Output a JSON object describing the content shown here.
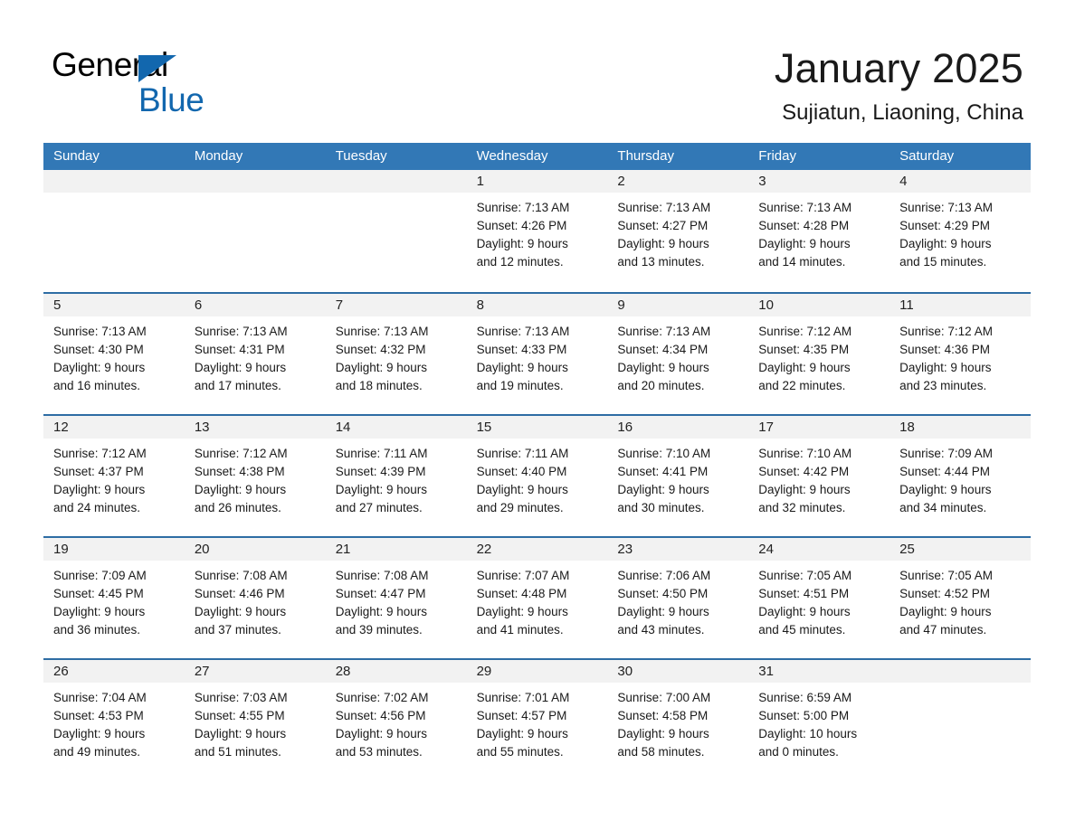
{
  "brand": {
    "name_line1": "General",
    "name_line2": "Blue",
    "flag_icon": "triangle-flag-icon",
    "accent_color": "#1267ae"
  },
  "header": {
    "month_title": "January 2025",
    "location": "Sujiatun, Liaoning, China"
  },
  "calendar": {
    "header_bg": "#3278b6",
    "row_divider_color": "#2e6da4",
    "date_band_bg": "#f2f2f2",
    "weekdays": [
      "Sunday",
      "Monday",
      "Tuesday",
      "Wednesday",
      "Thursday",
      "Friday",
      "Saturday"
    ],
    "weeks": [
      [
        {
          "date": "",
          "lines": []
        },
        {
          "date": "",
          "lines": []
        },
        {
          "date": "",
          "lines": []
        },
        {
          "date": "1",
          "lines": [
            "Sunrise: 7:13 AM",
            "Sunset: 4:26 PM",
            "Daylight: 9 hours",
            "and 12 minutes."
          ]
        },
        {
          "date": "2",
          "lines": [
            "Sunrise: 7:13 AM",
            "Sunset: 4:27 PM",
            "Daylight: 9 hours",
            "and 13 minutes."
          ]
        },
        {
          "date": "3",
          "lines": [
            "Sunrise: 7:13 AM",
            "Sunset: 4:28 PM",
            "Daylight: 9 hours",
            "and 14 minutes."
          ]
        },
        {
          "date": "4",
          "lines": [
            "Sunrise: 7:13 AM",
            "Sunset: 4:29 PM",
            "Daylight: 9 hours",
            "and 15 minutes."
          ]
        }
      ],
      [
        {
          "date": "5",
          "lines": [
            "Sunrise: 7:13 AM",
            "Sunset: 4:30 PM",
            "Daylight: 9 hours",
            "and 16 minutes."
          ]
        },
        {
          "date": "6",
          "lines": [
            "Sunrise: 7:13 AM",
            "Sunset: 4:31 PM",
            "Daylight: 9 hours",
            "and 17 minutes."
          ]
        },
        {
          "date": "7",
          "lines": [
            "Sunrise: 7:13 AM",
            "Sunset: 4:32 PM",
            "Daylight: 9 hours",
            "and 18 minutes."
          ]
        },
        {
          "date": "8",
          "lines": [
            "Sunrise: 7:13 AM",
            "Sunset: 4:33 PM",
            "Daylight: 9 hours",
            "and 19 minutes."
          ]
        },
        {
          "date": "9",
          "lines": [
            "Sunrise: 7:13 AM",
            "Sunset: 4:34 PM",
            "Daylight: 9 hours",
            "and 20 minutes."
          ]
        },
        {
          "date": "10",
          "lines": [
            "Sunrise: 7:12 AM",
            "Sunset: 4:35 PM",
            "Daylight: 9 hours",
            "and 22 minutes."
          ]
        },
        {
          "date": "11",
          "lines": [
            "Sunrise: 7:12 AM",
            "Sunset: 4:36 PM",
            "Daylight: 9 hours",
            "and 23 minutes."
          ]
        }
      ],
      [
        {
          "date": "12",
          "lines": [
            "Sunrise: 7:12 AM",
            "Sunset: 4:37 PM",
            "Daylight: 9 hours",
            "and 24 minutes."
          ]
        },
        {
          "date": "13",
          "lines": [
            "Sunrise: 7:12 AM",
            "Sunset: 4:38 PM",
            "Daylight: 9 hours",
            "and 26 minutes."
          ]
        },
        {
          "date": "14",
          "lines": [
            "Sunrise: 7:11 AM",
            "Sunset: 4:39 PM",
            "Daylight: 9 hours",
            "and 27 minutes."
          ]
        },
        {
          "date": "15",
          "lines": [
            "Sunrise: 7:11 AM",
            "Sunset: 4:40 PM",
            "Daylight: 9 hours",
            "and 29 minutes."
          ]
        },
        {
          "date": "16",
          "lines": [
            "Sunrise: 7:10 AM",
            "Sunset: 4:41 PM",
            "Daylight: 9 hours",
            "and 30 minutes."
          ]
        },
        {
          "date": "17",
          "lines": [
            "Sunrise: 7:10 AM",
            "Sunset: 4:42 PM",
            "Daylight: 9 hours",
            "and 32 minutes."
          ]
        },
        {
          "date": "18",
          "lines": [
            "Sunrise: 7:09 AM",
            "Sunset: 4:44 PM",
            "Daylight: 9 hours",
            "and 34 minutes."
          ]
        }
      ],
      [
        {
          "date": "19",
          "lines": [
            "Sunrise: 7:09 AM",
            "Sunset: 4:45 PM",
            "Daylight: 9 hours",
            "and 36 minutes."
          ]
        },
        {
          "date": "20",
          "lines": [
            "Sunrise: 7:08 AM",
            "Sunset: 4:46 PM",
            "Daylight: 9 hours",
            "and 37 minutes."
          ]
        },
        {
          "date": "21",
          "lines": [
            "Sunrise: 7:08 AM",
            "Sunset: 4:47 PM",
            "Daylight: 9 hours",
            "and 39 minutes."
          ]
        },
        {
          "date": "22",
          "lines": [
            "Sunrise: 7:07 AM",
            "Sunset: 4:48 PM",
            "Daylight: 9 hours",
            "and 41 minutes."
          ]
        },
        {
          "date": "23",
          "lines": [
            "Sunrise: 7:06 AM",
            "Sunset: 4:50 PM",
            "Daylight: 9 hours",
            "and 43 minutes."
          ]
        },
        {
          "date": "24",
          "lines": [
            "Sunrise: 7:05 AM",
            "Sunset: 4:51 PM",
            "Daylight: 9 hours",
            "and 45 minutes."
          ]
        },
        {
          "date": "25",
          "lines": [
            "Sunrise: 7:05 AM",
            "Sunset: 4:52 PM",
            "Daylight: 9 hours",
            "and 47 minutes."
          ]
        }
      ],
      [
        {
          "date": "26",
          "lines": [
            "Sunrise: 7:04 AM",
            "Sunset: 4:53 PM",
            "Daylight: 9 hours",
            "and 49 minutes."
          ]
        },
        {
          "date": "27",
          "lines": [
            "Sunrise: 7:03 AM",
            "Sunset: 4:55 PM",
            "Daylight: 9 hours",
            "and 51 minutes."
          ]
        },
        {
          "date": "28",
          "lines": [
            "Sunrise: 7:02 AM",
            "Sunset: 4:56 PM",
            "Daylight: 9 hours",
            "and 53 minutes."
          ]
        },
        {
          "date": "29",
          "lines": [
            "Sunrise: 7:01 AM",
            "Sunset: 4:57 PM",
            "Daylight: 9 hours",
            "and 55 minutes."
          ]
        },
        {
          "date": "30",
          "lines": [
            "Sunrise: 7:00 AM",
            "Sunset: 4:58 PM",
            "Daylight: 9 hours",
            "and 58 minutes."
          ]
        },
        {
          "date": "31",
          "lines": [
            "Sunrise: 6:59 AM",
            "Sunset: 5:00 PM",
            "Daylight: 10 hours",
            "and 0 minutes."
          ]
        },
        {
          "date": "",
          "lines": []
        }
      ]
    ]
  }
}
